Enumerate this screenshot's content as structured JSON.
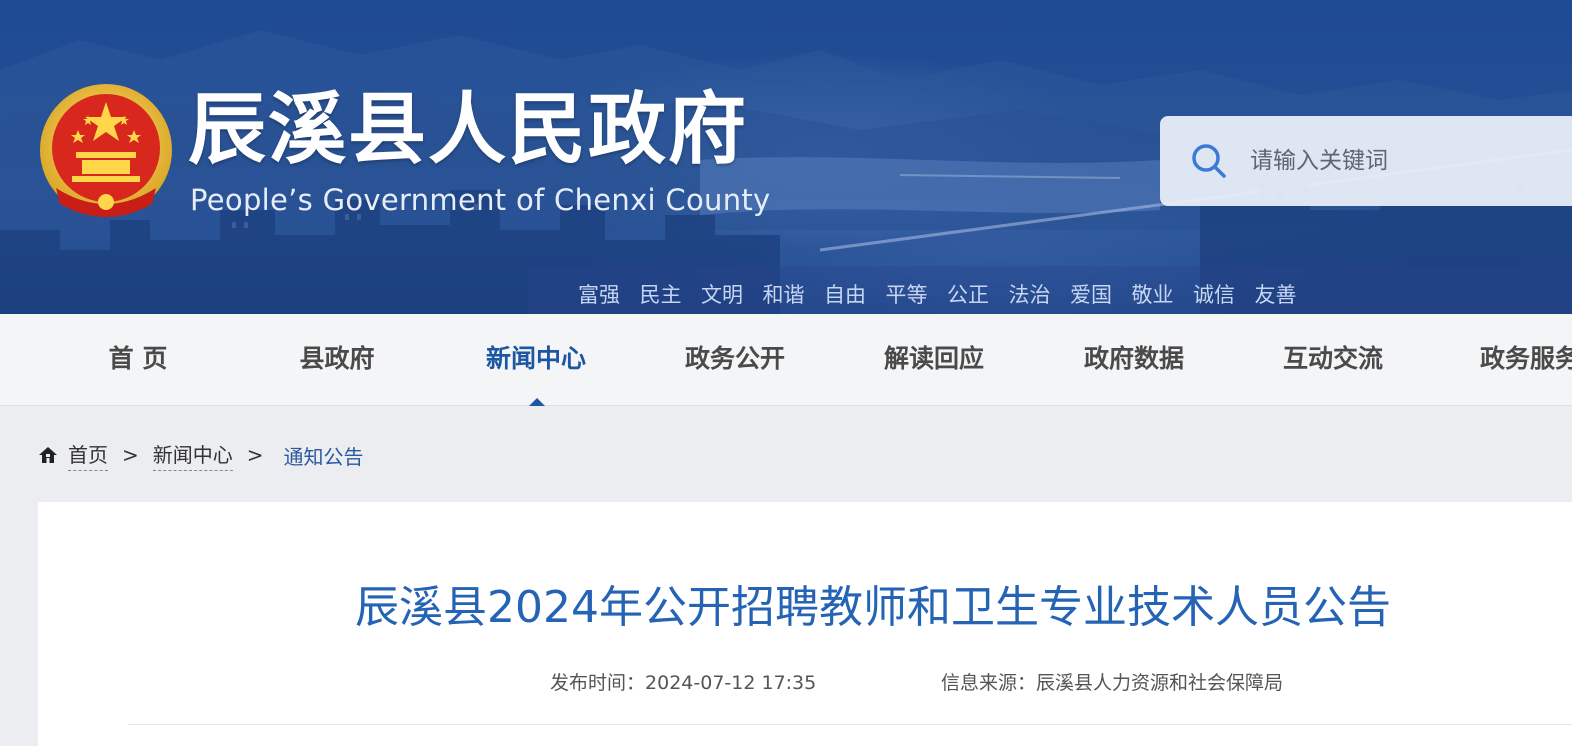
{
  "header": {
    "site_title": "辰溪县人民政府",
    "site_subtitle": "People’s Government of Chenxi County",
    "core_values": [
      "富强",
      "民主",
      "文明",
      "和谐",
      "自由",
      "平等",
      "公正",
      "法治",
      "爱国",
      "敬业",
      "诚信",
      "友善"
    ]
  },
  "search": {
    "placeholder": "请输入关键词"
  },
  "nav": {
    "items": [
      {
        "label": "首 页"
      },
      {
        "label": "县政府"
      },
      {
        "label": "新闻中心"
      },
      {
        "label": "政务公开"
      },
      {
        "label": "解读回应"
      },
      {
        "label": "政府数据"
      },
      {
        "label": "互动交流"
      },
      {
        "label": "政务服务"
      }
    ],
    "active_index": 2
  },
  "breadcrumb": {
    "home": "首页",
    "separator": ">",
    "section": "新闻中心",
    "current": "通知公告"
  },
  "article": {
    "title": "辰溪县2024年公开招聘教师和卫生专业技术人员公告",
    "publish_label": "发布时间：",
    "publish_time": "2024-07-12 17:35",
    "source_label": "信息来源：",
    "source": "辰溪县人力资源和社会保障局"
  },
  "colors": {
    "accent": "#1d56a3",
    "title_blue": "#2563b5",
    "banner_blue": "#244f95"
  }
}
